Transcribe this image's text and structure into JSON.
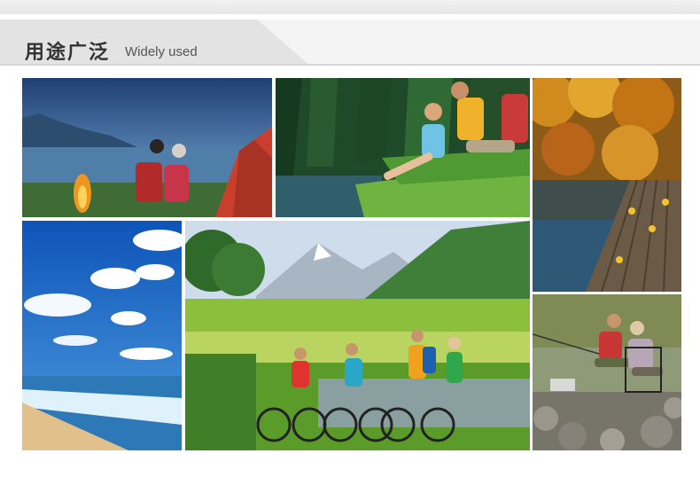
{
  "header": {
    "title_cn": "用途广泛",
    "title_en": "Widely used"
  },
  "gallery": {
    "photos": [
      {
        "name": "campfire-lake"
      },
      {
        "name": "couple-forest-stream"
      },
      {
        "name": "autumn-dock"
      },
      {
        "name": "beach-sky"
      },
      {
        "name": "cyclists-meadow"
      },
      {
        "name": "fishing-rocks"
      }
    ]
  }
}
